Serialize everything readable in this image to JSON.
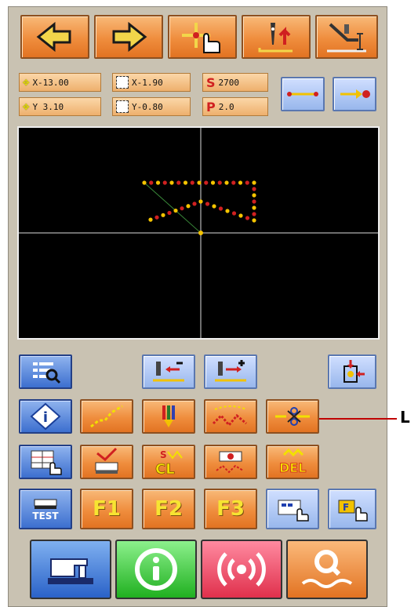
{
  "readouts": {
    "move_x": "X-13.00",
    "move_y": "Y  3.10",
    "scale_x": "X-1.90",
    "scale_y": "Y-0.80",
    "speed": "2700",
    "pitch": "2.0",
    "speed_letter": "S",
    "pitch_letter": "P"
  },
  "function_keys": {
    "f1": "F1",
    "f2": "F2",
    "f3": "F3",
    "test": "TEST"
  },
  "edit_labels": {
    "cl": "CL",
    "del": "DEL"
  },
  "callout": {
    "label": "L"
  },
  "colors": {
    "accent_orange": "#ef8d3d",
    "accent_blue": "#3c6fcf",
    "screen_bg": "#000000",
    "stitch_yellow": "#f5c400",
    "stitch_red": "#d02020",
    "callout_red": "#c00000"
  },
  "icons": [
    "arrow-left-icon",
    "arrow-right-icon",
    "cursor-hand-icon",
    "needle-up-icon",
    "presser-foot-icon",
    "move-arrows-icon",
    "scale-icon",
    "speed-icon",
    "pitch-icon",
    "line-stitch-icon",
    "end-point-icon",
    "search-list-icon",
    "delete-before-icon",
    "delete-after-icon",
    "origin-icon",
    "info-icon",
    "dashed-line-icon",
    "thread-icon",
    "zigzag-icon",
    "thread-trim-icon",
    "code-grid-icon",
    "machine-edit-icon",
    "clear-icon",
    "erase-icon",
    "delete-icon",
    "test-icon",
    "pattern-select-icon",
    "function-hand-icon",
    "sewing-machine-icon",
    "info-mode-icon",
    "communication-icon",
    "search-zoom-icon"
  ]
}
